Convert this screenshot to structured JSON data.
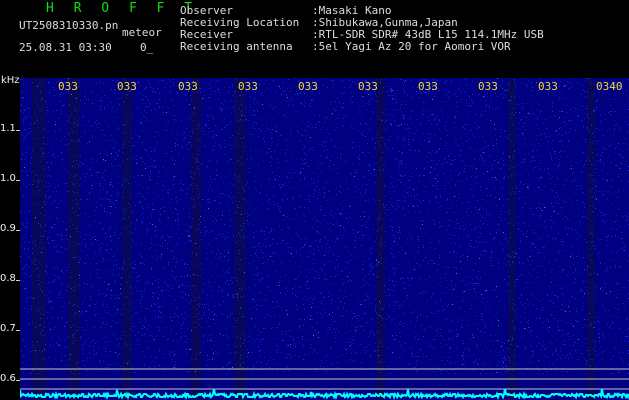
{
  "header": {
    "brand": "H R O F F T",
    "filename": "UT2508310330.pn",
    "meteor_label": "meteor",
    "timestamp": "25.08.31 03:30",
    "count_value": "0_"
  },
  "info": [
    {
      "key": "Observer",
      "value": ":Masaki Kano"
    },
    {
      "key": "Receiving Location",
      "value": ":Shibukawa,Gunma,Japan"
    },
    {
      "key": "Receiver",
      "value": ":RTL-SDR SDR# 43dB L15 114.1MHz USB"
    },
    {
      "key": "Receiving antenna",
      "value": ":5el Yagi Az 20 for Aomori VOR"
    }
  ],
  "axis": {
    "unit": "kHz",
    "labels": [
      "1.1",
      "1.0",
      "0.9",
      "0.8",
      "0.7",
      "0.6"
    ]
  },
  "time_labels": [
    "033",
    "033",
    "033",
    "033",
    "033",
    "033",
    "033",
    "033",
    "033",
    "0340"
  ],
  "colors": {
    "brand": "#11dd11",
    "meta_text": "#dddddd",
    "axis_text": "#f0f0f0",
    "time_text": "#f3dd33",
    "waterfall_base": "#000080",
    "speckle": "#1f2cff",
    "baseline": "#00ffff"
  }
}
